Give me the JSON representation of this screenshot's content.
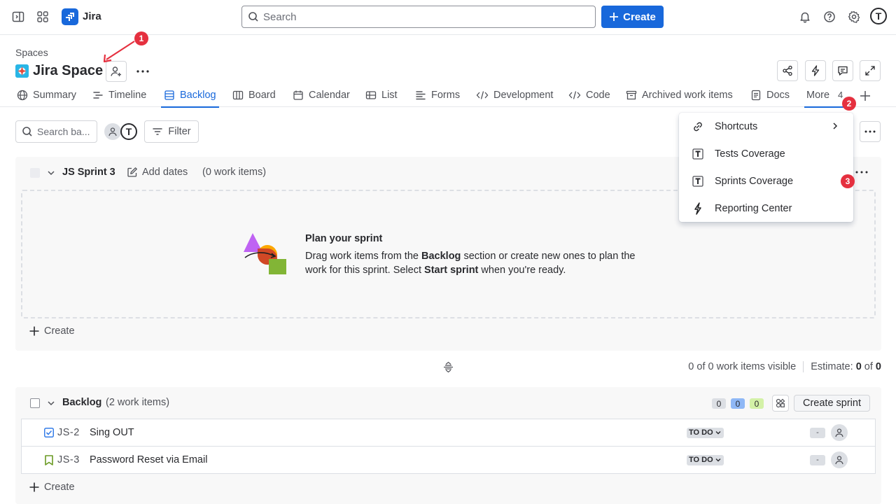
{
  "topnav": {
    "app_name": "Jira",
    "search_placeholder": "Search",
    "create_label": "Create",
    "avatar_initial": "T"
  },
  "header": {
    "breadcrumb": "Spaces",
    "space_title": "Jira Space"
  },
  "tabs": [
    {
      "label": "Summary",
      "icon": "globe-icon"
    },
    {
      "label": "Timeline",
      "icon": "timeline-icon"
    },
    {
      "label": "Backlog",
      "icon": "backlog-icon",
      "active": true
    },
    {
      "label": "Board",
      "icon": "board-icon"
    },
    {
      "label": "Calendar",
      "icon": "calendar-icon"
    },
    {
      "label": "List",
      "icon": "list-icon"
    },
    {
      "label": "Forms",
      "icon": "forms-icon"
    },
    {
      "label": "Development",
      "icon": "code-icon"
    },
    {
      "label": "Code",
      "icon": "code-icon"
    },
    {
      "label": "Archived work items",
      "icon": "archive-icon"
    },
    {
      "label": "Docs",
      "icon": "docs-icon"
    },
    {
      "label": "More",
      "count": "4"
    }
  ],
  "toolbar": {
    "search_placeholder": "Search ba...",
    "filter_label": "Filter",
    "avatar_initial": "T"
  },
  "sprint": {
    "name": "JS Sprint 3",
    "add_dates": "Add dates",
    "count": "(0 work items)",
    "plan_title": "Plan your sprint",
    "plan_text_1": "Drag work items from the ",
    "plan_text_bold_1": "Backlog",
    "plan_text_2": " section or create new ones to plan the work for this sprint. Select ",
    "plan_text_bold_2": "Start sprint",
    "plan_text_3": " when you're ready.",
    "create_label": "Create"
  },
  "status": {
    "visible": "0 of 0 work items visible",
    "estimate_label": "Estimate:",
    "estimate_done": "0",
    "of": "of",
    "estimate_total": "0"
  },
  "backlog": {
    "title": "Backlog",
    "count": "(2 work items)",
    "pills": [
      "0",
      "0",
      "0"
    ],
    "create_sprint": "Create sprint",
    "create_label": "Create",
    "items": [
      {
        "key": "JS-2",
        "summary": "Sing OUT",
        "status": "TO DO",
        "estimate": "-",
        "type": "task-icon"
      },
      {
        "key": "JS-3",
        "summary": "Password Reset via Email",
        "status": "TO DO",
        "estimate": "-",
        "type": "story-icon"
      }
    ]
  },
  "menu": {
    "items": [
      {
        "label": "Shortcuts",
        "icon": "link-icon",
        "has_submenu": true
      },
      {
        "label": "Tests Coverage",
        "icon": "tests-app-icon"
      },
      {
        "label": "Sprints Coverage",
        "icon": "tests-app-icon"
      },
      {
        "label": "Reporting Center",
        "icon": "lightning-app-icon"
      }
    ]
  },
  "annotations": [
    "1",
    "2",
    "3"
  ],
  "colors": {
    "brand": "#1868db",
    "annotation": "#e5303f"
  }
}
